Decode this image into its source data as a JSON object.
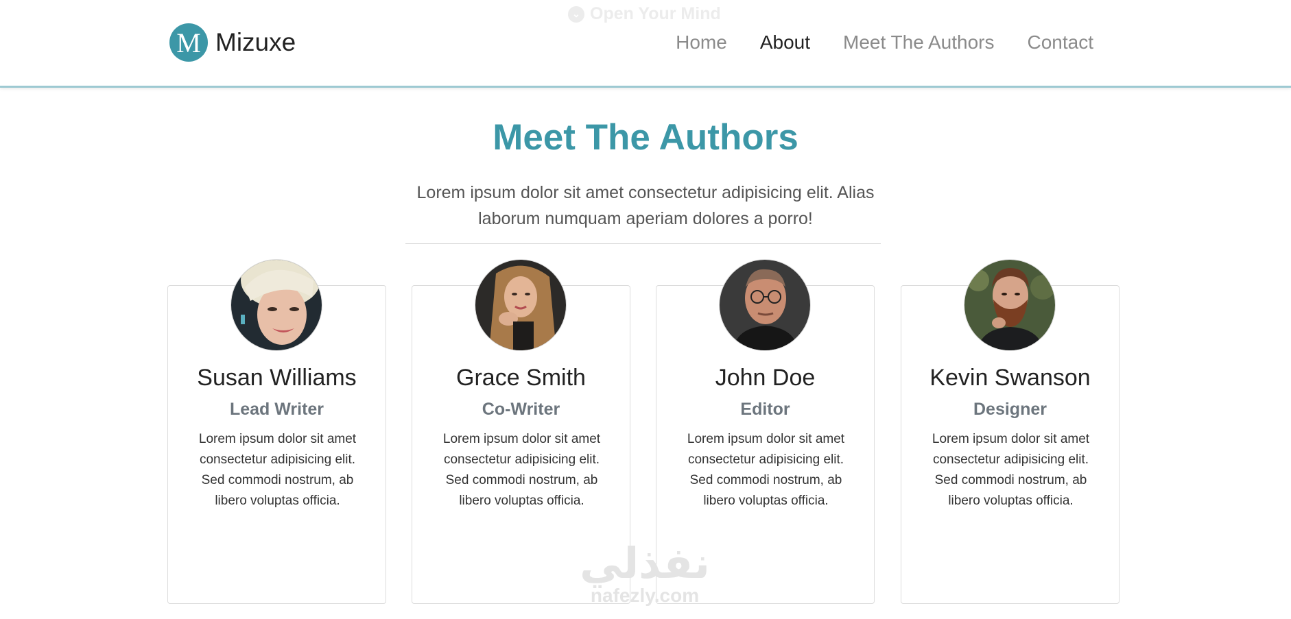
{
  "ghost_text": "Open Your Mind",
  "brand": {
    "logo_letter": "M",
    "name": "Mizuxe"
  },
  "nav": [
    {
      "label": "Home"
    },
    {
      "label": "About"
    },
    {
      "label": "Meet The Authors"
    },
    {
      "label": "Contact"
    }
  ],
  "section": {
    "title": "Meet The Authors",
    "lead": "Lorem ipsum dolor sit amet consectetur adipisicing elit. Alias laborum numquam aperiam dolores a porro!"
  },
  "authors": [
    {
      "name": "Susan Williams",
      "role": "Lead Writer",
      "bio": "Lorem ipsum dolor sit amet consectetur adipisicing elit. Sed commodi nostrum, ab libero voluptas officia."
    },
    {
      "name": "Grace Smith",
      "role": "Co-Writer",
      "bio": "Lorem ipsum dolor sit amet consectetur adipisicing elit. Sed commodi nostrum, ab libero voluptas officia."
    },
    {
      "name": "John Doe",
      "role": "Editor",
      "bio": "Lorem ipsum dolor sit amet consectetur adipisicing elit. Sed commodi nostrum, ab libero voluptas officia."
    },
    {
      "name": "Kevin Swanson",
      "role": "Designer",
      "bio": "Lorem ipsum dolor sit amet consectetur adipisicing elit. Sed commodi nostrum, ab libero voluptas officia."
    }
  ],
  "watermark": {
    "arabic": "نفذلي",
    "latin": "nafezly.com"
  },
  "colors": {
    "accent": "#3c97a7",
    "nav_active": "#222222",
    "nav_inactive": "#8b8b8b"
  }
}
